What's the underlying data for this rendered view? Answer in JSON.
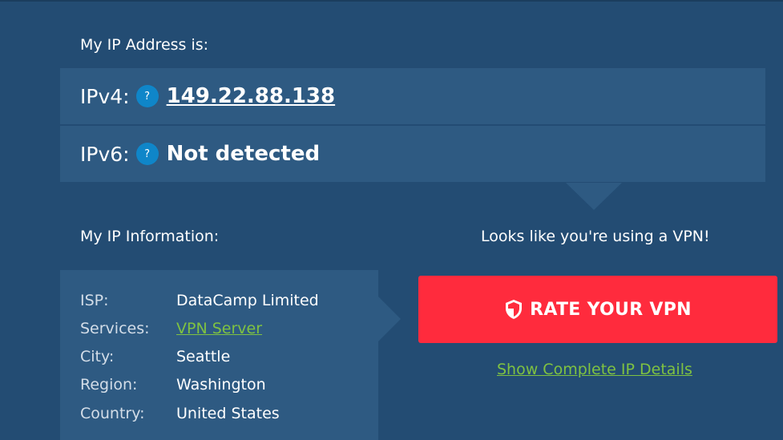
{
  "colors": {
    "background": "#234c73",
    "panel": "#2e5a82",
    "accent_red": "#ff2b3d",
    "link_green": "#7fc241",
    "help_blue": "#0f86c9"
  },
  "ip_section": {
    "title": "My IP Address is:",
    "ipv4": {
      "label": "IPv4:",
      "help_icon": "?",
      "value": "149.22.88.138"
    },
    "ipv6": {
      "label": "IPv6:",
      "help_icon": "?",
      "value": "Not detected"
    }
  },
  "info_section": {
    "title": "My IP Information:",
    "rows": [
      {
        "key": "ISP:",
        "value": "DataCamp Limited"
      },
      {
        "key": "Services:",
        "value": "VPN Server"
      },
      {
        "key": "City:",
        "value": "Seattle"
      },
      {
        "key": "Region:",
        "value": "Washington"
      },
      {
        "key": "Country:",
        "value": "United States"
      }
    ]
  },
  "vpn_panel": {
    "message": "Looks like you're using a VPN!",
    "rate_button_label": "RATE YOUR VPN",
    "rate_button_icon": "shield-icon",
    "details_link": "Show Complete IP Details"
  }
}
